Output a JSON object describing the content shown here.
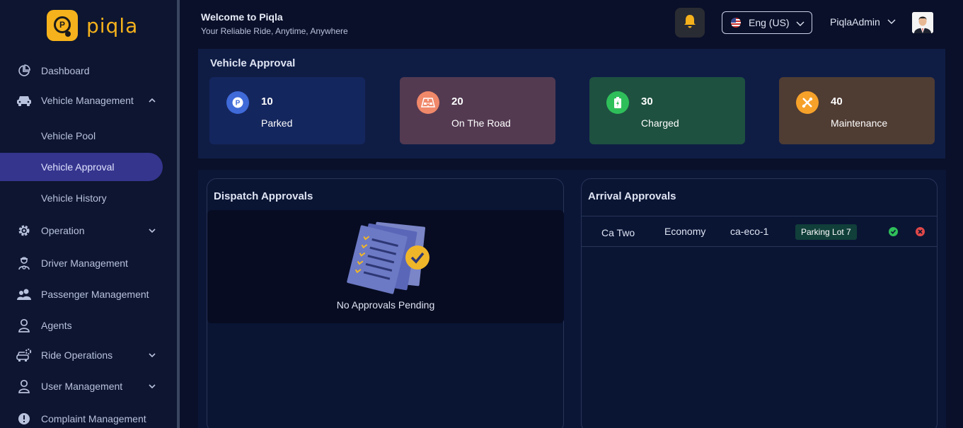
{
  "brand": {
    "name": "piqla"
  },
  "sidebar": {
    "items": [
      {
        "label": "Dashboard",
        "icon": "pie-chart-icon"
      },
      {
        "label": "Vehicle Management",
        "icon": "car-icon",
        "expanded": true
      },
      {
        "label": "Vehicle Pool"
      },
      {
        "label": "Vehicle Approval",
        "active": true
      },
      {
        "label": "Vehicle History"
      },
      {
        "label": "Operation",
        "icon": "gear-icon"
      },
      {
        "label": "Driver Management",
        "icon": "driver-icon"
      },
      {
        "label": "Passenger Management",
        "icon": "users-icon"
      },
      {
        "label": "Agents",
        "icon": "person-icon"
      },
      {
        "label": "Ride Operations",
        "icon": "car-settings-icon"
      },
      {
        "label": "User Management",
        "icon": "person-icon"
      },
      {
        "label": "Complaint Management",
        "icon": "alert-icon"
      }
    ]
  },
  "header": {
    "title": "Welcome to Piqla",
    "subtitle": "Your Reliable Ride, Anytime, Anywhere",
    "language": "Eng (US)",
    "username": "PiqlaAdmin"
  },
  "vehicle_approval": {
    "title": "Vehicle Approval",
    "cards": [
      {
        "value": "10",
        "label": "Parked",
        "color": "#14265e",
        "icon_color": "#3f6ad8",
        "icon": "parking-icon"
      },
      {
        "value": "20",
        "label": "On The Road",
        "color": "#533a51",
        "icon_color": "#f0886a",
        "icon": "road-icon"
      },
      {
        "value": "30",
        "label": "Charged",
        "color": "#1e5140",
        "icon_color": "#2fbf5a",
        "icon": "battery-icon"
      },
      {
        "value": "40",
        "label": "Maintenance",
        "color": "#4f3c33",
        "icon_color": "#f6a12a",
        "icon": "tools-icon"
      }
    ]
  },
  "dispatch": {
    "title": "Dispatch Approvals",
    "empty_text": "No Approvals Pending"
  },
  "arrival": {
    "title": "Arrival Approvals",
    "rows": [
      {
        "name": "Ca Two",
        "category": "Economy",
        "code": "ca-eco-1",
        "location": "Parking Lot 7"
      }
    ]
  },
  "colors": {
    "accent": "#35358e",
    "brand": "#f5b21c",
    "approve": "#2fbf5a",
    "reject": "#e04848"
  }
}
